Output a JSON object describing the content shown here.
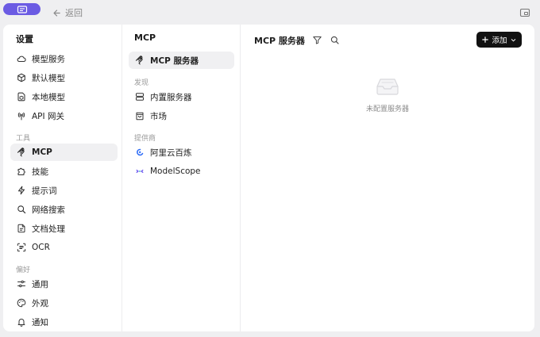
{
  "topbar": {
    "back_label": "返回"
  },
  "sidebar": {
    "title": "设置",
    "items": [
      {
        "label": "模型服务",
        "icon": "cloud-icon"
      },
      {
        "label": "默认模型",
        "icon": "cube-icon"
      },
      {
        "label": "本地模型",
        "icon": "file-cube-icon"
      },
      {
        "label": "API 网关",
        "icon": "antenna-icon"
      }
    ],
    "tools_label": "工具",
    "tools": [
      {
        "label": "MCP",
        "icon": "mcp-icon",
        "active": true
      },
      {
        "label": "技能",
        "icon": "puzzle-icon"
      },
      {
        "label": "提示词",
        "icon": "lightning-icon"
      },
      {
        "label": "网络搜索",
        "icon": "search-icon"
      },
      {
        "label": "文档处理",
        "icon": "document-icon"
      },
      {
        "label": "OCR",
        "icon": "scan-text-icon"
      }
    ],
    "prefs_label": "偏好",
    "prefs": [
      {
        "label": "通用",
        "icon": "sliders-icon"
      },
      {
        "label": "外观",
        "icon": "palette-icon"
      },
      {
        "label": "通知",
        "icon": "bell-icon"
      }
    ]
  },
  "mcp_panel": {
    "title": "MCP",
    "servers_item": "MCP 服务器",
    "discover_label": "发现",
    "discover": [
      {
        "label": "内置服务器",
        "icon": "server-icon"
      },
      {
        "label": "市场",
        "icon": "bag-icon"
      }
    ],
    "providers_label": "提供商",
    "providers": [
      {
        "label": "阿里云百炼",
        "icon": "bailian-logo-icon",
        "color": "#2f6df6"
      },
      {
        "label": "ModelScope",
        "icon": "modelscope-logo-icon",
        "color": "#6a56f0"
      }
    ]
  },
  "main": {
    "title": "MCP 服务器",
    "add_label": "添加",
    "empty_text": "未配置服务器"
  },
  "colors": {
    "accent": "#6b5be3",
    "button_bg": "#111111"
  }
}
